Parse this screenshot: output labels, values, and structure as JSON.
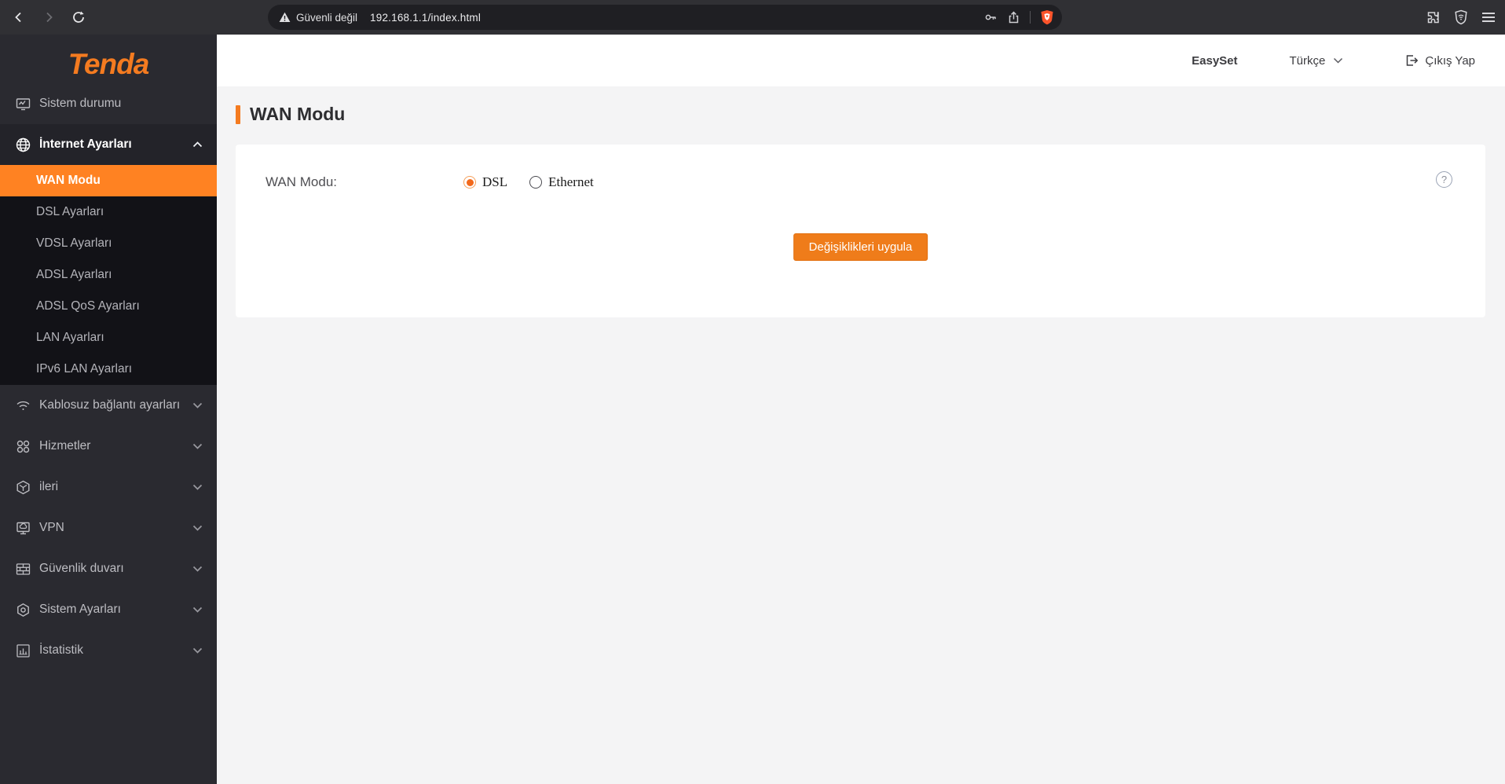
{
  "browser": {
    "security_warning": "Güvenli değil",
    "url": "192.168.1.1/index.html"
  },
  "header": {
    "easyset": "EasySet",
    "language": "Türkçe",
    "logout": "Çıkış Yap"
  },
  "sidebar": {
    "logo": "Tenda",
    "items": [
      {
        "label": "Sistem durumu",
        "icon": "monitor-status-icon"
      },
      {
        "label": "İnternet Ayarları",
        "icon": "globe-icon",
        "expanded": true
      },
      {
        "label": "Kablosuz bağlantı ayarları",
        "icon": "wifi-icon"
      },
      {
        "label": "Hizmetler",
        "icon": "services-icon"
      },
      {
        "label": "ileri",
        "icon": "cube-icon"
      },
      {
        "label": "VPN",
        "icon": "vpn-monitor-icon"
      },
      {
        "label": "Güvenlik duvarı",
        "icon": "firewall-icon"
      },
      {
        "label": "Sistem Ayarları",
        "icon": "settings-icon"
      },
      {
        "label": "İstatistik",
        "icon": "statistics-icon"
      }
    ],
    "submenu": [
      {
        "label": "WAN Modu",
        "active": true
      },
      {
        "label": "DSL Ayarları"
      },
      {
        "label": "VDSL Ayarları"
      },
      {
        "label": "ADSL Ayarları"
      },
      {
        "label": "ADSL QoS Ayarları"
      },
      {
        "label": "LAN Ayarları"
      },
      {
        "label": "IPv6 LAN Ayarları"
      }
    ]
  },
  "main": {
    "title": "WAN Modu",
    "form": {
      "field_label": "WAN Modu:",
      "options": [
        {
          "label": "DSL",
          "selected": true
        },
        {
          "label": "Ethernet",
          "selected": false
        }
      ],
      "apply_button": "Değişiklikleri uygula"
    }
  },
  "colors": {
    "brand_orange": "#f47b20",
    "active_item_orange": "#ff8222",
    "button_orange": "#ef7c1a",
    "sidebar_bg": "#2a2a30",
    "submenu_bg": "#121217",
    "toolbar_bg": "#303034",
    "brave_shield": "#fb542b"
  }
}
